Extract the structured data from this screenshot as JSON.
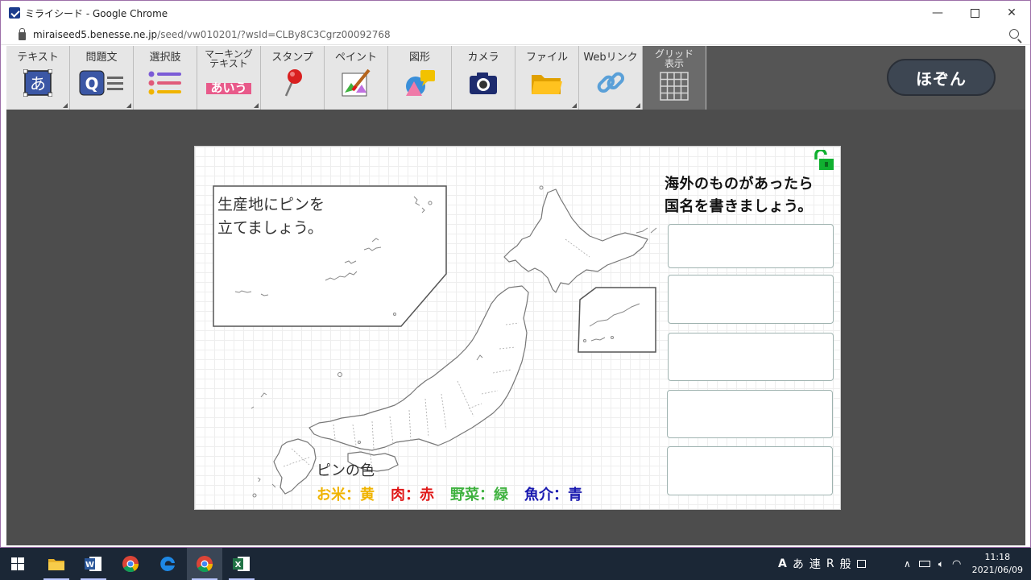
{
  "browser": {
    "title": "ミライシード - Google Chrome",
    "url_host": "miraiseed5.benesse.ne.jp",
    "url_path": "/seed/vw010201/?wsId=CLBy8C3Cgrz00092768",
    "controls": [
      "minimize-icon",
      "maximize-icon",
      "close-icon"
    ]
  },
  "toolbar": {
    "tools": [
      {
        "label": "テキスト",
        "icon": "text-icon",
        "icon_text": "あ"
      },
      {
        "label": "問題文",
        "icon": "question-text-icon",
        "icon_text": "Q"
      },
      {
        "label": "選択肢",
        "icon": "choices-icon"
      },
      {
        "label_line1": "マーキング",
        "label_line2": "テキスト",
        "icon": "marking-text-icon",
        "icon_text": "あいう"
      },
      {
        "label": "スタンプ",
        "icon": "pin-stamp-icon"
      },
      {
        "label": "ペイント",
        "icon": "paint-icon"
      },
      {
        "label": "図形",
        "icon": "shapes-icon"
      },
      {
        "label": "カメラ",
        "icon": "camera-icon"
      },
      {
        "label": "ファイル",
        "icon": "folder-icon"
      },
      {
        "label": "Webリンク",
        "icon": "link-icon"
      },
      {
        "label_line1": "グリッド",
        "label_line2": "表示",
        "icon": "grid-icon"
      }
    ],
    "save_label": "ほぞん"
  },
  "card": {
    "instruction_line1": "生産地にピンを",
    "instruction_line2": "立てましょう。",
    "question_line1": "海外のものがあったら",
    "question_line2": "国名を書きましょう。",
    "answers": [
      "",
      "",
      "",
      "",
      ""
    ],
    "legend_title": "ピンの色",
    "legend": [
      {
        "text": "お米：黄",
        "color": "#f0b400"
      },
      {
        "text": "肉：赤",
        "color": "#e01818"
      },
      {
        "text": "野菜：緑",
        "color": "#3fb23f"
      },
      {
        "text": "魚介：青",
        "color": "#1a1ab0"
      }
    ],
    "lock_state": "unlocked"
  },
  "taskbar": {
    "apps": [
      "windows-start-icon",
      "file-explorer-icon",
      "word-icon",
      "chrome-icon",
      "edge-icon",
      "chrome-active-icon",
      "excel-icon"
    ],
    "ime": [
      "A",
      "あ",
      "連",
      "R",
      "般"
    ],
    "time": "11:18",
    "date": "2021/06/09"
  }
}
